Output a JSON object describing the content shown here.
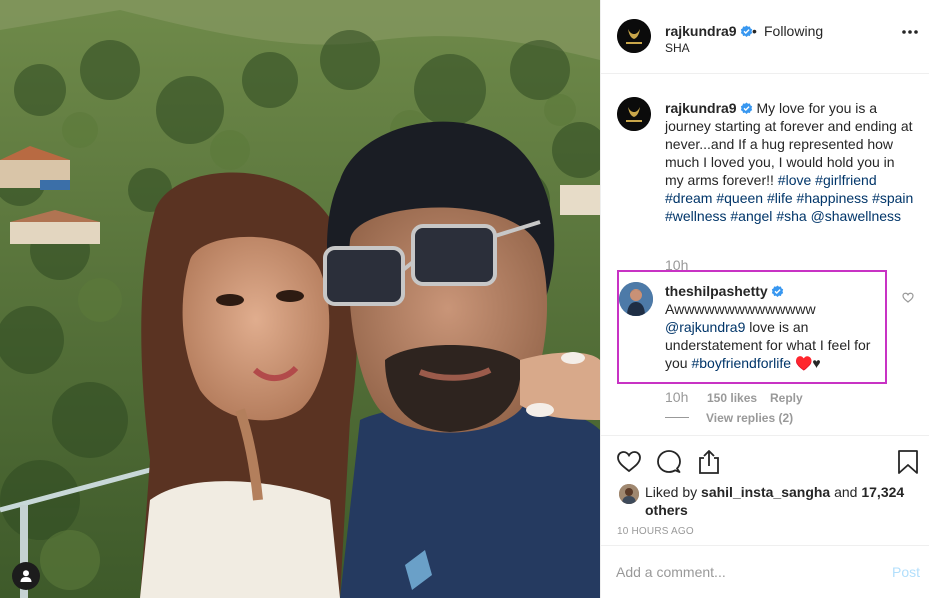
{
  "header": {
    "username": "rajkundra9",
    "separator": "•",
    "follow_status": "Following",
    "location": "SHA",
    "more_icon": "more-horizontal-icon"
  },
  "caption": {
    "username": "rajkundra9",
    "text": "My love for you is a journey starting at forever and ending at never...and If a hug represented how much I loved you, I would hold you in my arms forever!!",
    "hashtags": [
      "#love",
      "#girlfriend",
      "#dream",
      "#queen",
      "#life",
      "#happiness",
      "#spain",
      "#wellness",
      "#angel",
      "#sha"
    ],
    "mention": "@shawellness",
    "time": "10h"
  },
  "reply": {
    "username": "theshilpashetty",
    "text_start": "Awwwwwwwwwwwwww",
    "mention": "@rajkundra9",
    "text_mid": "love is an understatement for what I feel for you",
    "hashtag": "#boyfriendforlife",
    "emoji": "♥️♥",
    "time": "10h",
    "likes": "150 likes",
    "reply_label": "Reply",
    "view_replies": "View replies (2)"
  },
  "actions": {
    "liked_by_prefix": "Liked by",
    "liked_by_user": "sahil_insta_sangha",
    "liked_and": "and",
    "others": "17,324 others",
    "post_time": "10 HOURS AGO"
  },
  "add_comment": {
    "placeholder": "Add a comment...",
    "post_label": "Post"
  },
  "colors": {
    "verified_blue": "#3897f0",
    "link_blue": "#003569",
    "muted": "#999999",
    "highlight_border": "#c832c4",
    "post_disabled": "#b2dffc"
  }
}
